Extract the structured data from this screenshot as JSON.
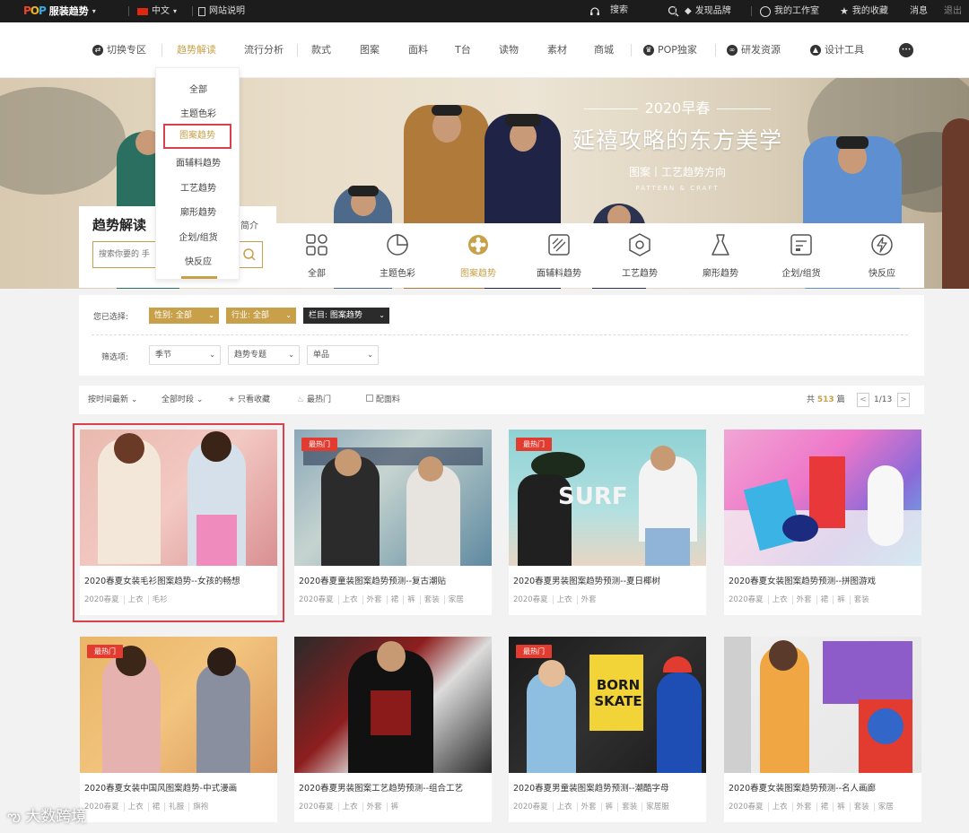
{
  "topbar": {
    "brand": "服装趋势",
    "brand_dropdown": "▾",
    "language": "中文",
    "site_guide": "网站说明",
    "search_label": "搜索",
    "discover_brand": "发现品牌",
    "my_workspace": "我的工作室",
    "my_favorites": "我的收藏",
    "messages": "消息",
    "logout": "退出"
  },
  "nav": {
    "items": [
      {
        "label": "切换专区"
      },
      {
        "label": "趋势解读"
      },
      {
        "label": "流行分析"
      },
      {
        "label": "款式"
      },
      {
        "label": "图案"
      },
      {
        "label": "面料"
      },
      {
        "label": "T台"
      },
      {
        "label": "读物"
      },
      {
        "label": "素材"
      },
      {
        "label": "商城"
      },
      {
        "label": "POP独家"
      },
      {
        "label": "研发资源"
      },
      {
        "label": "设计工具"
      }
    ],
    "more": "•••"
  },
  "dropdown": {
    "items": [
      "全部",
      "主题色彩",
      "图案趋势",
      "面辅料趋势",
      "工艺趋势",
      "廓形趋势",
      "企划/组货",
      "快反应"
    ]
  },
  "banner": {
    "line1": "2020早春",
    "line2": "延禧攻略的东方美学",
    "line3": "图案丨工艺趋势方向",
    "line4": "PATTERN & CRAFT"
  },
  "trend_panel": {
    "title": "趋势解读",
    "intro": "简介",
    "search_placeholder": "搜索你要的 手"
  },
  "categories": [
    {
      "label": "全部",
      "icon": "grid-icon"
    },
    {
      "label": "主题色彩",
      "icon": "pie-icon"
    },
    {
      "label": "图案趋势",
      "icon": "flower-icon"
    },
    {
      "label": "面辅料趋势",
      "icon": "fabric-icon"
    },
    {
      "label": "工艺趋势",
      "icon": "hexagon-icon"
    },
    {
      "label": "廓形趋势",
      "icon": "dress-icon"
    },
    {
      "label": "企划/组货",
      "icon": "plan-icon"
    },
    {
      "label": "快反应",
      "icon": "lightning-icon"
    }
  ],
  "filter": {
    "selected_label": "您已选择:",
    "chips": [
      "性别: 全部",
      "行业: 全部",
      "栏目: 图案趋势"
    ],
    "filter_label": "筛选项:",
    "selects": [
      "季节",
      "趋势专题",
      "单品"
    ]
  },
  "sortbar": {
    "sort_time": "按时间最新",
    "all_time": "全部时段",
    "favorites_only": "只看收藏",
    "hottest": "最热门",
    "fabric": "配面料",
    "total_prefix": "共",
    "total_count": "513",
    "total_suffix": "篇",
    "prev": "<",
    "page": "1/13",
    "next": ">"
  },
  "cards": [
    {
      "title": "2020春夏女装毛衫图案趋势--女孩的畅想",
      "tags": [
        "2020春夏",
        "上衣",
        "毛衫"
      ],
      "hot": false
    },
    {
      "title": "2020春夏童装图案趋势预测--复古潮贴",
      "tags": [
        "2020春夏",
        "上衣",
        "外套",
        "裙",
        "裤",
        "套装",
        "家居"
      ],
      "hot": true
    },
    {
      "title": "2020春夏男装图案趋势预测--夏日椰树",
      "tags": [
        "2020春夏",
        "上衣",
        "外套"
      ],
      "hot": true
    },
    {
      "title": "2020春夏女装图案趋势预测--拼图游戏",
      "tags": [
        "2020春夏",
        "上衣",
        "外套",
        "裙",
        "裤",
        "套装"
      ],
      "hot": false
    },
    {
      "title": "2020春夏女装中国风图案趋势-中式漫画",
      "tags": [
        "2020春夏",
        "上衣",
        "裙",
        "礼服",
        "旗袍"
      ],
      "hot": true
    },
    {
      "title": "2020春夏男装图案工艺趋势预测--组合工艺",
      "tags": [
        "2020春夏",
        "上衣",
        "外套",
        "裤"
      ],
      "hot": false
    },
    {
      "title": "2020春夏男童装图案趋势预测--潮酷字母",
      "tags": [
        "2020春夏",
        "上衣",
        "外套",
        "裤",
        "套装",
        "家居服"
      ],
      "hot": true
    },
    {
      "title": "2020春夏女装图案趋势预测--名人画廊",
      "tags": [
        "2020春夏",
        "上衣",
        "外套",
        "裙",
        "裤",
        "套装",
        "家居"
      ],
      "hot": false
    }
  ],
  "hot_label": "最热门",
  "watermark": "大数跨境",
  "colors": {
    "accent": "#c8a04a",
    "highlight_border": "#d9414e",
    "hot_badge": "#e23b30",
    "topbar": "#1c1c1c"
  }
}
